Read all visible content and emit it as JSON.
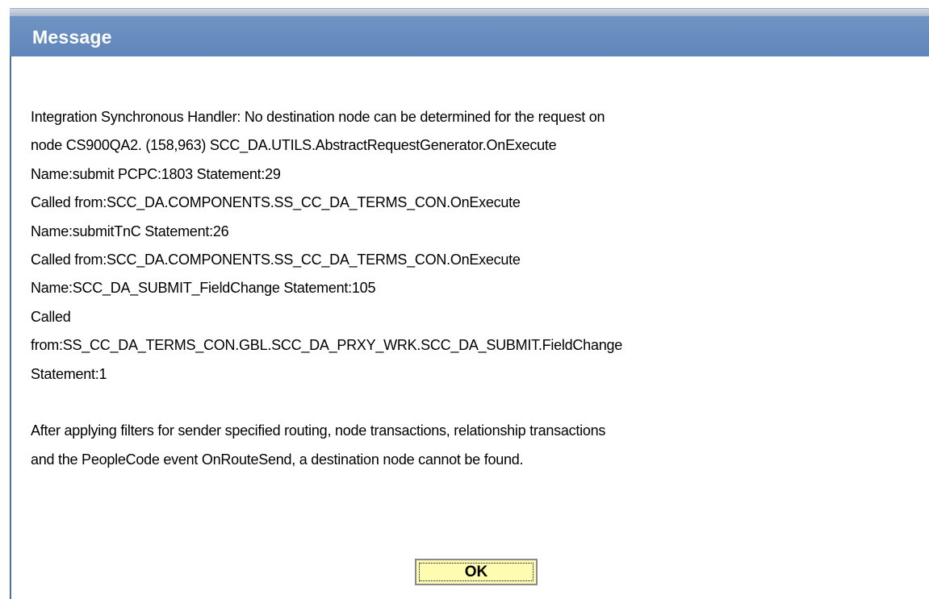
{
  "dialog": {
    "title": "Message",
    "message_lines": [
      "Integration Synchronous Handler: No destination node can be determined for the request on",
      "node CS900QA2. (158,963) SCC_DA.UTILS.AbstractRequestGenerator.OnExecute",
      "Name:submit  PCPC:1803  Statement:29",
      "Called from:SCC_DA.COMPONENTS.SS_CC_DA_TERMS_CON.OnExecute",
      "Name:submitTnC  Statement:26",
      "Called from:SCC_DA.COMPONENTS.SS_CC_DA_TERMS_CON.OnExecute",
      "Name:SCC_DA_SUBMIT_FieldChange  Statement:105",
      "Called",
      "from:SS_CC_DA_TERMS_CON.GBL.SCC_DA_PRXY_WRK.SCC_DA_SUBMIT.FieldChange",
      "Statement:1"
    ],
    "explanation_lines": [
      "After applying filters for sender specified routing, node transactions, relationship transactions",
      "and the PeopleCode event OnRouteSend, a destination node cannot be found."
    ],
    "ok_label": "OK"
  },
  "colors": {
    "title_bar": "#6f95c4",
    "title_text": "#ffffff",
    "button_face": "#fefcb0",
    "button_border": "#8a8a8a",
    "body_text": "#000000"
  }
}
